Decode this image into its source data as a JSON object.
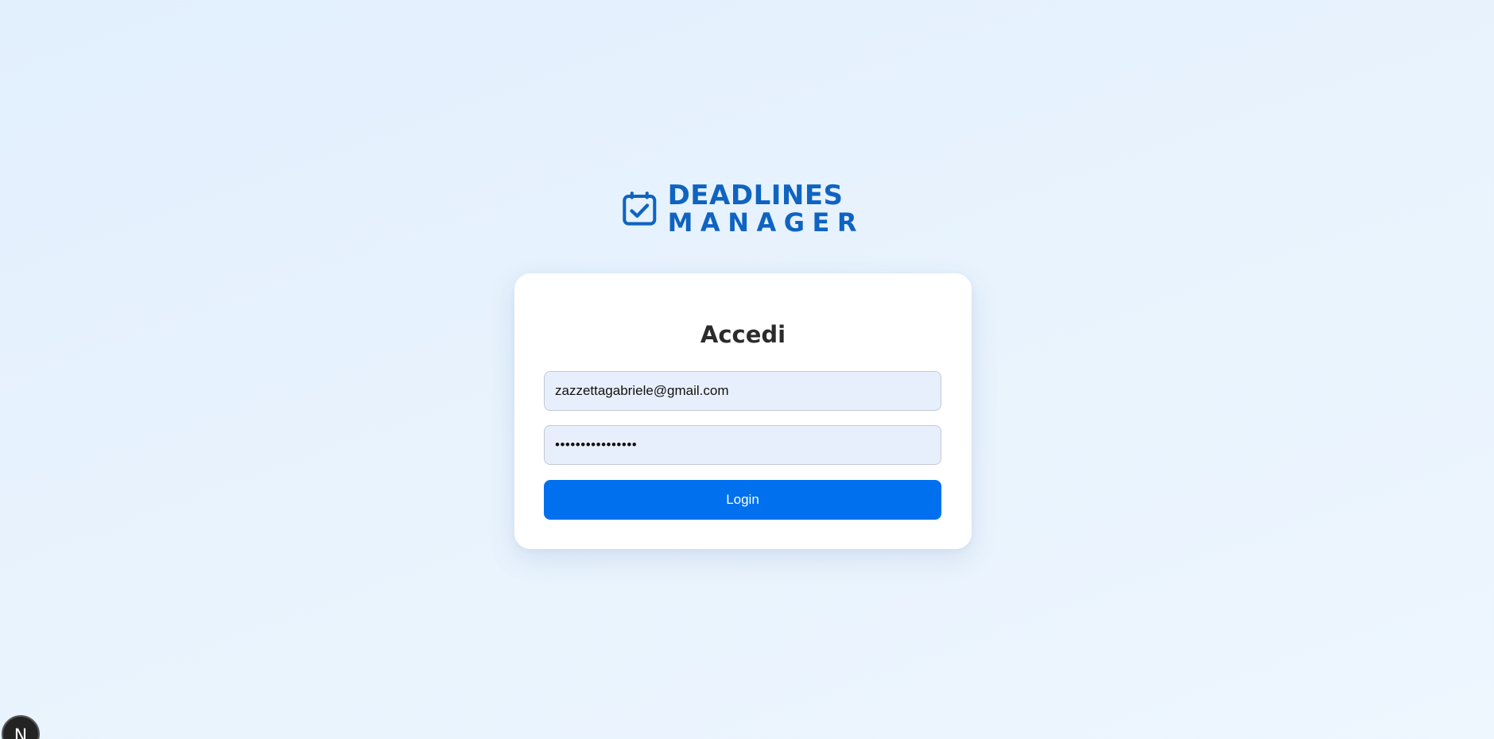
{
  "brand": {
    "line1": "DEADLINES",
    "line2": "MANAGER",
    "logo_icon": "calendar-check-icon",
    "color": "#0f63c1"
  },
  "login": {
    "title": "Accedi",
    "email_value": "zazzettagabriele@gmail.com",
    "password_value": "••••••••••••••••",
    "button_label": "Login",
    "button_color": "#0070ef"
  },
  "dev_indicator": {
    "label": "N"
  }
}
